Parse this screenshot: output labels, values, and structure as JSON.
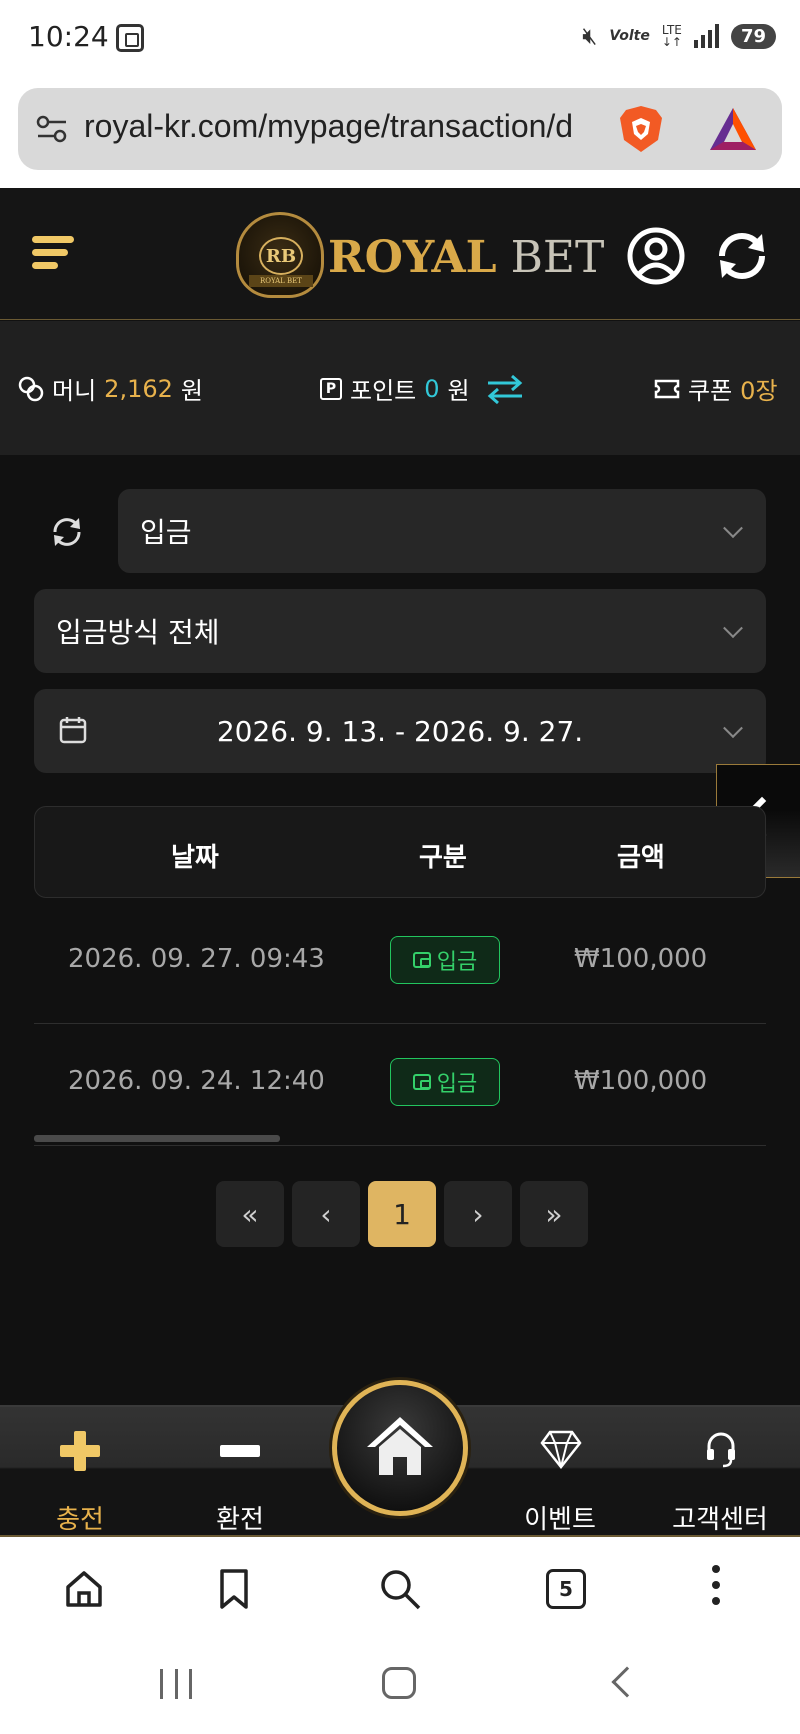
{
  "status_bar": {
    "time": "10:24",
    "lte": "LTE",
    "volte": "Volte",
    "battery": "79"
  },
  "browser": {
    "url": "royal-kr.com/mypage/transaction/d",
    "tab_count": "5"
  },
  "header": {
    "logo_text_royal": "ROYAL",
    "logo_text_bet": "BET",
    "logo_crest": "RB",
    "logo_band": "ROYAL BET"
  },
  "balance": {
    "money_label": "머니",
    "money_value": "2,162",
    "money_unit": "원",
    "point_label": "포인트",
    "point_value": "0",
    "point_unit": "원",
    "coupon_label": "쿠폰",
    "coupon_value": "0장"
  },
  "filters": {
    "type_selected": "입금",
    "method_selected": "입금방식 전체",
    "date_range": "2026. 9. 13. - 2026. 9. 27."
  },
  "table": {
    "headers": [
      "날짜",
      "구분",
      "금액"
    ],
    "rows": [
      {
        "date": "2026. 09. 27. 09:43",
        "type": "입금",
        "amount": "₩100,000"
      },
      {
        "date": "2026. 09. 24. 12:40",
        "type": "입금",
        "amount": "₩100,000"
      }
    ]
  },
  "pagination": {
    "first": "«",
    "prev": "‹",
    "current": "1",
    "next": "›",
    "last": "»"
  },
  "bottom_nav": {
    "charge": "충전",
    "exchange": "환전",
    "event": "이벤트",
    "support": "고객센터"
  },
  "colors": {
    "accent_gold": "#e8b24c",
    "point_cyan": "#32c8d8",
    "deposit_green": "#34d06a",
    "background": "#111111"
  }
}
